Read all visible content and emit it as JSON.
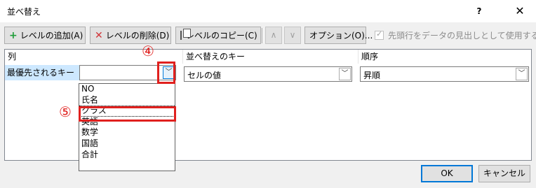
{
  "window": {
    "title": "並べ替え",
    "help_label": "?",
    "close_label": "✕"
  },
  "toolbar": {
    "add_level": "レベルの追加(A)",
    "delete_level": "レベルの削除(D)",
    "copy_level": "レベルのコピー(C)",
    "move_up": "∧",
    "move_down": "∨",
    "options": "オプション(O)...",
    "header_checkbox_label": "先頭行をデータの見出しとして使用する(H)",
    "header_checkbox_checked": true
  },
  "grid": {
    "columns": [
      "列",
      "並べ替えのキー",
      "順序"
    ],
    "row_label": "最優先されるキー",
    "column_value": "",
    "sort_on_value": "セルの値",
    "order_value": "昇順"
  },
  "dropdown": {
    "options": [
      "NO",
      "氏名",
      "クラス",
      "英語",
      "数学",
      "国語",
      "合計"
    ],
    "highlighted": "クラス"
  },
  "annotations": {
    "step4": "④",
    "step5": "⑤"
  },
  "buttons": {
    "ok": "OK",
    "cancel": "キャンセル"
  },
  "colors": {
    "annotation_red": "#e0201e",
    "selection_blue": "#cde8ff",
    "focus_blue": "#0078d7"
  }
}
